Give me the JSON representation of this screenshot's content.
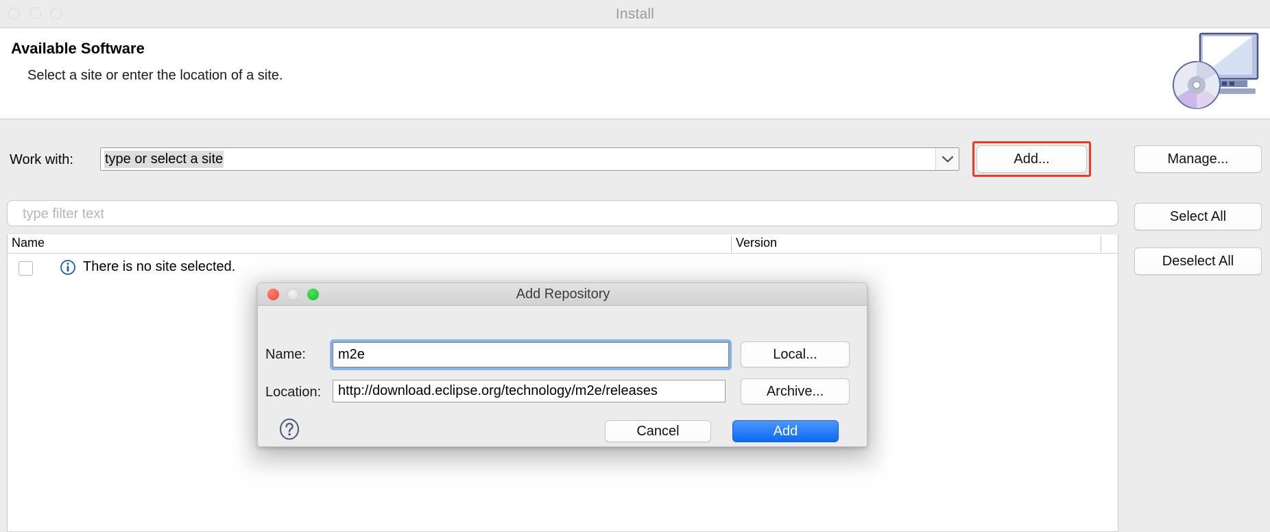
{
  "window": {
    "title": "Install",
    "traffic_lights": [
      "close-dot",
      "minimize-dot",
      "zoom-dot"
    ]
  },
  "banner": {
    "title": "Available Software",
    "subtitle": "Select a site or enter the location of a site.",
    "icon": "install-cd-monitor-icon"
  },
  "work_with": {
    "label": "Work with:",
    "value": "type or select a site",
    "dropdown_icon": "chevron-down-icon"
  },
  "buttons": {
    "add": "Add...",
    "manage": "Manage...",
    "select_all": "Select All",
    "deselect_all": "Deselect All"
  },
  "filter": {
    "placeholder": "type filter text",
    "value": ""
  },
  "table": {
    "columns": [
      "Name",
      "Version"
    ],
    "rows": [
      {
        "checked": false,
        "icon": "info-icon",
        "name": "There is no site selected.",
        "version": ""
      }
    ]
  },
  "dialog": {
    "title": "Add Repository",
    "traffic_lights": [
      "close-dot",
      "minimize-dot",
      "zoom-dot"
    ],
    "fields": [
      {
        "label": "Name:",
        "value": "m2e",
        "focused": true
      },
      {
        "label": "Location:",
        "value": "http://download.eclipse.org/technology/m2e/releases",
        "focused": false
      }
    ],
    "side_buttons": {
      "local": "Local...",
      "archive": "Archive..."
    },
    "help_icon": "question-mark-help-icon",
    "cancel": "Cancel",
    "add": "Add"
  },
  "colors": {
    "highlight_outline": "#f5371f",
    "primary_button": "#0a6cf5",
    "focus_ring": "#5096e6",
    "info_blue": "#1a5fb4",
    "window_chrome": "#ececec"
  }
}
